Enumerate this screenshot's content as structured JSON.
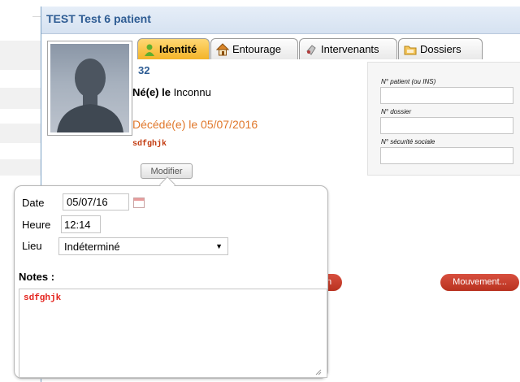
{
  "window": {
    "title": "TEST Test 6 patient"
  },
  "tabs": [
    {
      "label": "Identité",
      "icon": "person-icon",
      "active": true
    },
    {
      "label": "Entourage",
      "icon": "house-icon",
      "active": false
    },
    {
      "label": "Intervenants",
      "icon": "hand-icon",
      "active": false
    },
    {
      "label": "Dossiers",
      "icon": "folder-icon",
      "active": false
    }
  ],
  "identity": {
    "number": "32",
    "born_label": "Né(e) le",
    "born_value": "Inconnu",
    "death_text": "Décédé(e) le 05/07/2016",
    "code": "sdfghjk",
    "modify_label": "Modifier"
  },
  "fields": [
    {
      "label": "N° patient (ou INS)",
      "value": ""
    },
    {
      "label": "N° dossier",
      "value": ""
    },
    {
      "label": "N° sécurité sociale",
      "value": ""
    }
  ],
  "actions": {
    "migration_label": "Migration",
    "movement_label": "Mouvement..."
  },
  "popup": {
    "date_label": "Date",
    "date_value": "05/07/16",
    "time_label": "Heure",
    "time_value": "12:14",
    "place_label": "Lieu",
    "place_value": "Indéterminé",
    "notes_label": "Notes :",
    "notes_value": "sdfghjk"
  },
  "colors": {
    "title": "#2e5c93",
    "death": "#e0772a",
    "notes": "#e4211b",
    "action_button": "#c9402d"
  }
}
